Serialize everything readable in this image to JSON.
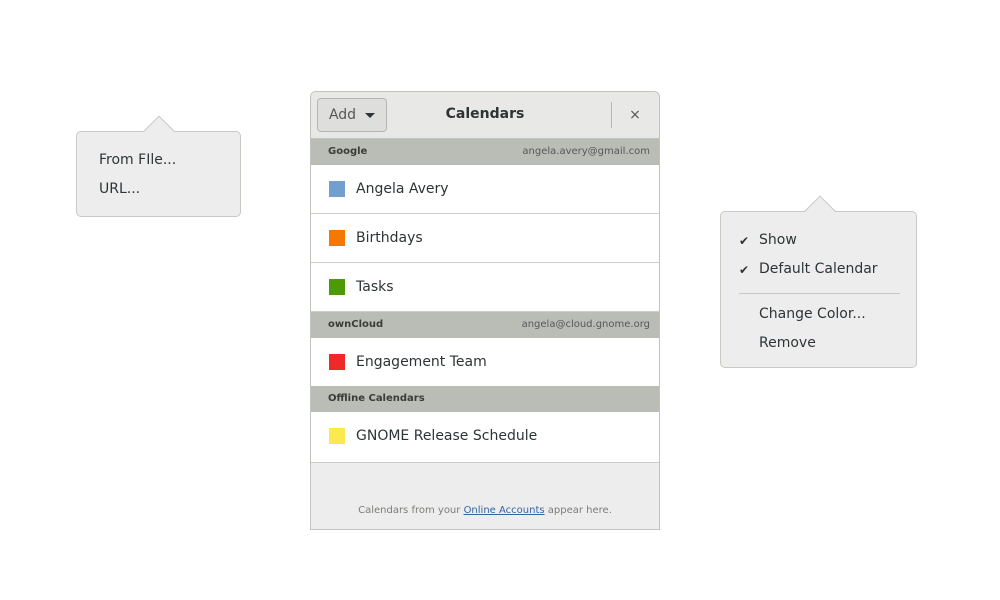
{
  "add_popover": {
    "items": [
      "From FIle...",
      "URL..."
    ]
  },
  "dialog": {
    "title": "Calendars",
    "add_button_label": "Add",
    "close_glyph": "×",
    "sections": [
      {
        "name": "Google",
        "account": "angela.avery@gmail.com",
        "calendars": [
          {
            "name": "Angela Avery",
            "color": "#729fcf"
          },
          {
            "name": "Birthdays",
            "color": "#f57900"
          },
          {
            "name": "Tasks",
            "color": "#4e9a06"
          }
        ]
      },
      {
        "name": "ownCloud",
        "account": "angela@cloud.gnome.org",
        "calendars": [
          {
            "name": "Engagement Team",
            "color": "#ef2929"
          }
        ]
      },
      {
        "name": "Offline Calendars",
        "account": "",
        "calendars": [
          {
            "name": "GNOME Release Schedule",
            "color": "#fce94f"
          }
        ]
      }
    ],
    "footer": {
      "before": "Calendars from your ",
      "link": "Online Accounts",
      "after": " appear here."
    }
  },
  "context_popover": {
    "check_glyph": "✔",
    "show_label": "Show",
    "show_checked": true,
    "default_label": "Default Calendar",
    "default_checked": true,
    "change_color_label": "Change Color...",
    "remove_label": "Remove"
  },
  "icons": {
    "add_caret": "caret-down-icon",
    "close": "close-icon",
    "check": "check-icon"
  }
}
